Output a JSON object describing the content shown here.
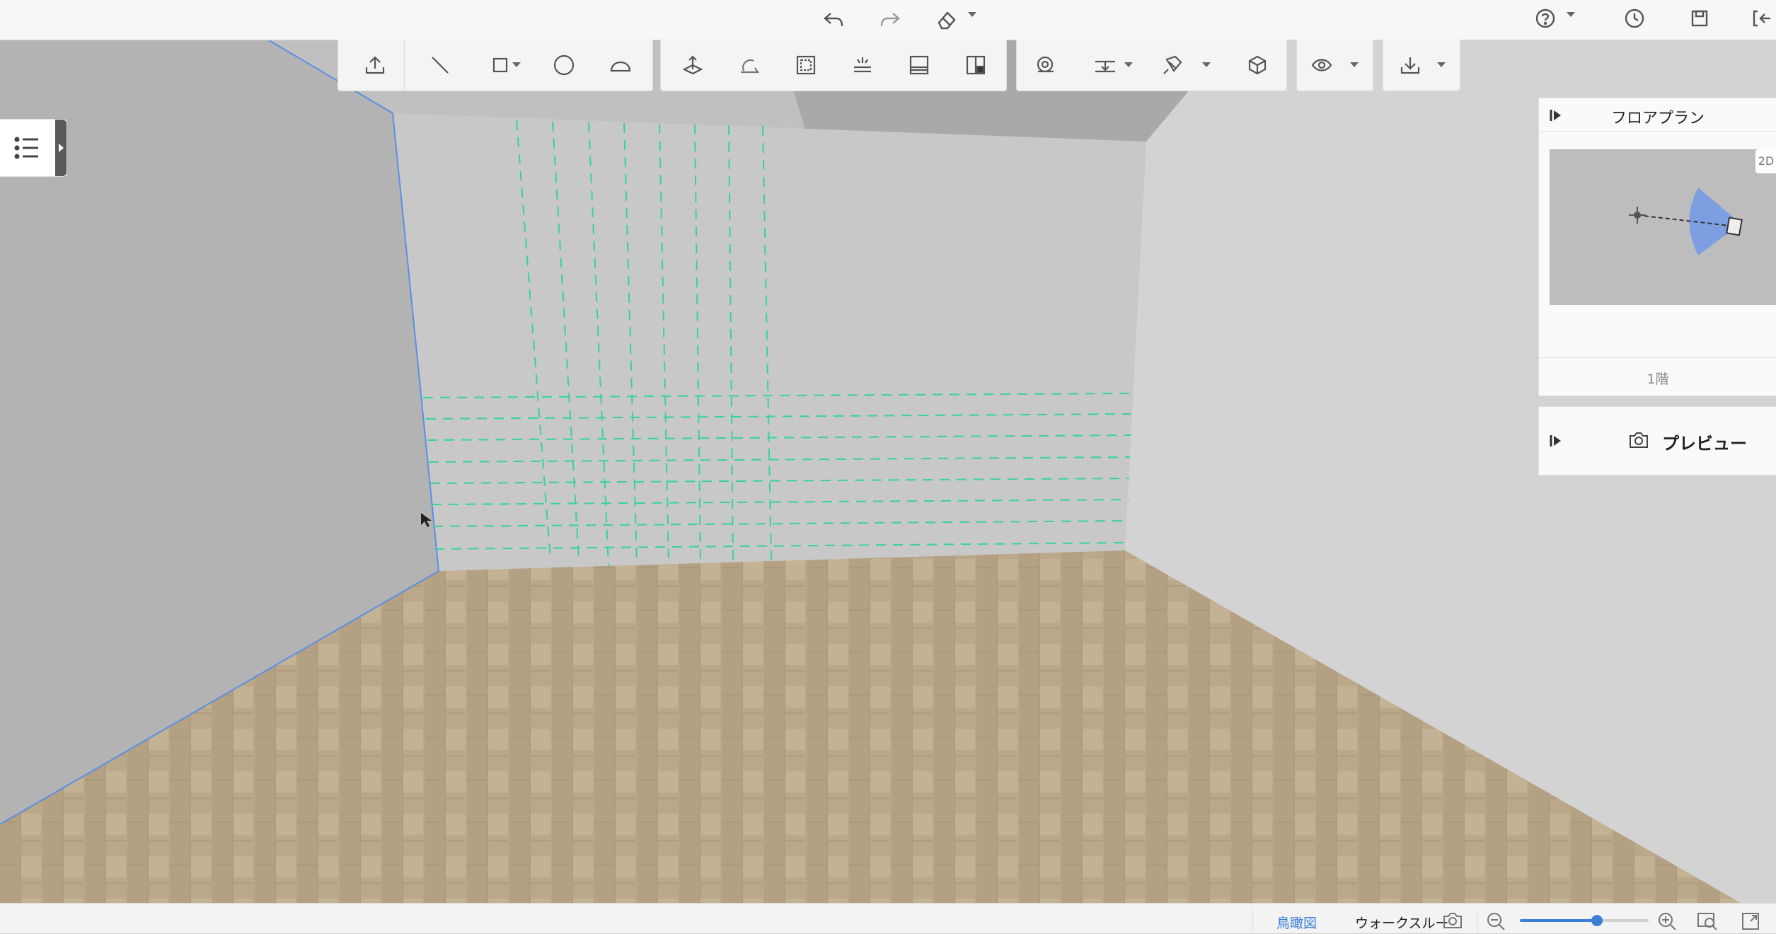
{
  "top_bar": {
    "icons": [
      "undo-icon",
      "redo-icon",
      "eraser-icon",
      "help-icon",
      "history-icon",
      "save-icon",
      "exit-icon"
    ]
  },
  "toolbar": {
    "groups": [
      {
        "tools": [
          "upload-icon"
        ]
      },
      {
        "tools": [
          "line-icon",
          "rectangle-icon",
          "circle-icon",
          "arc-icon"
        ]
      },
      {
        "tools": [
          "push-pull-icon",
          "rotate-icon",
          "offset-icon",
          "light-icon",
          "wall-panel-icon",
          "layout-icon"
        ]
      },
      {
        "tools": [
          "tape-measure-icon",
          "dimension-icon",
          "paint-icon",
          "cube-icon"
        ]
      },
      {
        "tools": [
          "eye-icon"
        ]
      },
      {
        "tools": [
          "download-icon"
        ]
      }
    ]
  },
  "left_panel": {
    "icon": "list-icon"
  },
  "floorplan": {
    "title": "フロアプラン",
    "mode_badge": "2D",
    "floor_label": "1階"
  },
  "preview": {
    "title": "プレビュー"
  },
  "bottom_bar": {
    "view_birdseye": "鳥瞰図",
    "view_walkthrough": "ウォークスルー",
    "zoom_level": 0.6
  },
  "colors": {
    "accent": "#3b7fd9",
    "guide_line": "#35d49a",
    "wall": "#c9c9c9",
    "floor": "#b9a589"
  }
}
